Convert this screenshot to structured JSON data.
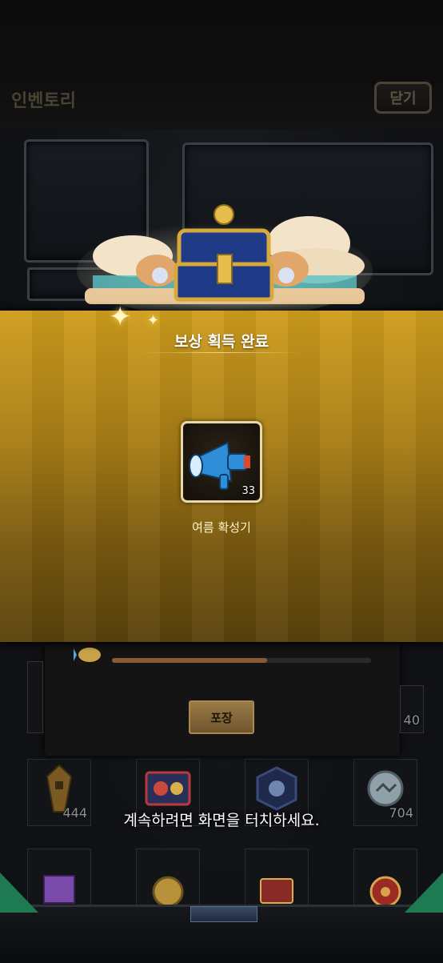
{
  "header": {
    "title": "인벤토리",
    "close_label": "닫기"
  },
  "reward": {
    "title": "보상 획득 완료",
    "item_name": "여름 확성기",
    "item_count": "33"
  },
  "background_panel": {
    "pack_label": "포장",
    "progress_fraction": 0.6
  },
  "inventory_counts": {
    "cell_1": "444",
    "cell_4": "704",
    "cell_right_top": "40"
  },
  "continue_prompt": "계속하려면 화면을 터치하세요.",
  "colors": {
    "gold_band": "#cf9e1d",
    "slot_border": "#e9d7a8",
    "pack_button": "#9a7a45"
  }
}
